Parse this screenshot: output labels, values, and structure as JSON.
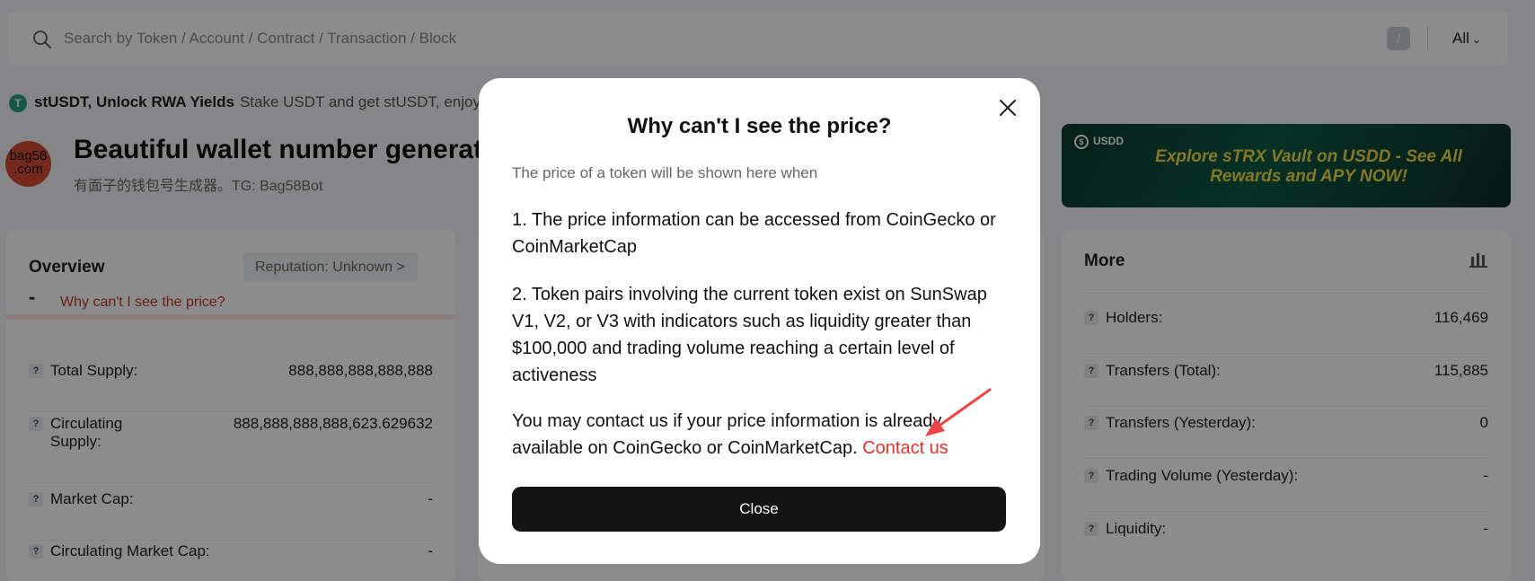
{
  "search": {
    "placeholder": "Search by Token / Account / Contract / Transaction / Block",
    "slash_key": "/",
    "filter_label": "All"
  },
  "promo": {
    "title": "stUSDT, Unlock RWA Yields",
    "text": "Stake USDT and get stUSDT, enjoy l"
  },
  "token": {
    "logo_line1": "bag58",
    "logo_line2": ".com",
    "name": "Beautiful wallet number generato",
    "subtitle": "有面子的钱包号生成器。TG: Bag58Bot"
  },
  "banner": {
    "brand": "USDD",
    "text": "Explore sTRX Vault on USDD - See All Rewards and APY NOW!"
  },
  "overview": {
    "title": "Overview",
    "reputation": "Reputation: Unknown >",
    "price_dash": "-",
    "price_link": "Why can't I see the price?",
    "rows": [
      {
        "label": "Total Supply:",
        "value": "888,888,888,888,888"
      },
      {
        "label": "Circulating",
        "label2": "Supply:",
        "value": "888,888,888,888,623.629632"
      },
      {
        "label": "Market Cap:",
        "value": "-"
      },
      {
        "label": "Circulating Market Cap:",
        "value": "-"
      }
    ]
  },
  "more": {
    "title": "More",
    "rows": [
      {
        "label": "Holders:",
        "value": "116,469"
      },
      {
        "label": "Transfers (Total):",
        "value": "115,885"
      },
      {
        "label": "Transfers (Yesterday):",
        "value": "0"
      },
      {
        "label": "Trading Volume (Yesterday):",
        "value": "-"
      },
      {
        "label": "Liquidity:",
        "value": "-"
      }
    ]
  },
  "modal": {
    "title": "Why can't I see the price?",
    "intro": "The price of a token will be shown here when",
    "p1": "1. The price information can be accessed from CoinGecko or CoinMarketCap",
    "p2": "2. Token pairs involving the current token exist on SunSwap V1, V2, or V3 with indicators such as liquidity greater than $100,000 and trading volume reaching a certain level of activeness",
    "p3": "You may contact us if your price information is already available on CoinGecko or CoinMarketCap.",
    "contact_link": "Contact us",
    "close_button": "Close"
  },
  "icons": {
    "search": "search-icon",
    "close": "close-icon",
    "bar_chart": "bar-chart-icon",
    "tether": "tether-icon",
    "help": "question-icon"
  },
  "colors": {
    "link_red": "#e0342a",
    "button_dark": "#141414",
    "banner_yellow": "#f2d94a"
  }
}
